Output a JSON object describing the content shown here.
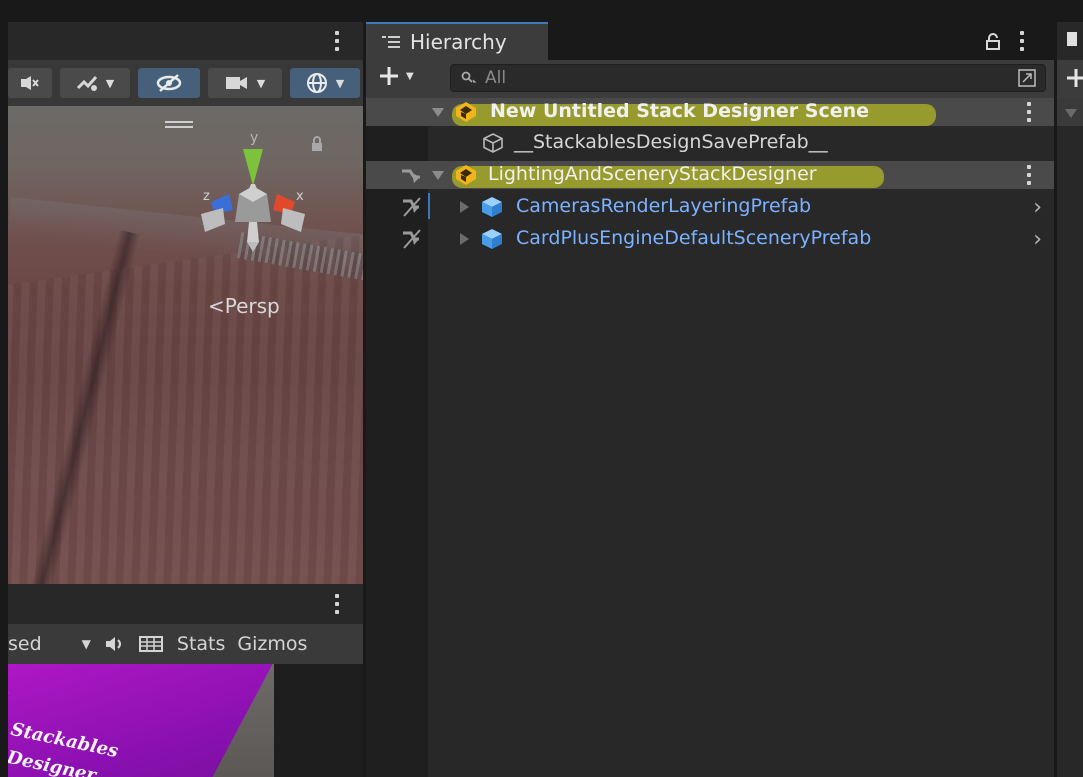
{
  "scene_view": {
    "camera_mode_label": "Persp",
    "axes": {
      "y": "y",
      "x": "x",
      "z": "z"
    }
  },
  "game_view": {
    "display_partial": "sed",
    "stats_label": "Stats",
    "gizmos_label": "Gizmos",
    "card_text_line1": "Stackables",
    "card_text_line2": "Designer"
  },
  "hierarchy": {
    "tab_label": "Hierarchy",
    "search_placeholder": "All",
    "rows": [
      {
        "label": "New Untitled Stack Designer Scene",
        "type": "scene",
        "highlighted": true
      },
      {
        "label": "__StackablesDesignSavePrefab__",
        "type": "gameobject"
      },
      {
        "label": "LightingAndSceneryStackDesigner",
        "type": "scene",
        "highlighted": true
      },
      {
        "label": "CamerasRenderLayeringPrefab",
        "type": "prefab"
      },
      {
        "label": "CardPlusEngineDefaultSceneryPrefab",
        "type": "prefab"
      }
    ]
  },
  "colors": {
    "highlight": "#d7dc14",
    "prefab_text": "#7bb2ff",
    "scene_text": "#f0f0f0",
    "tab_accent": "#3a79bb"
  }
}
